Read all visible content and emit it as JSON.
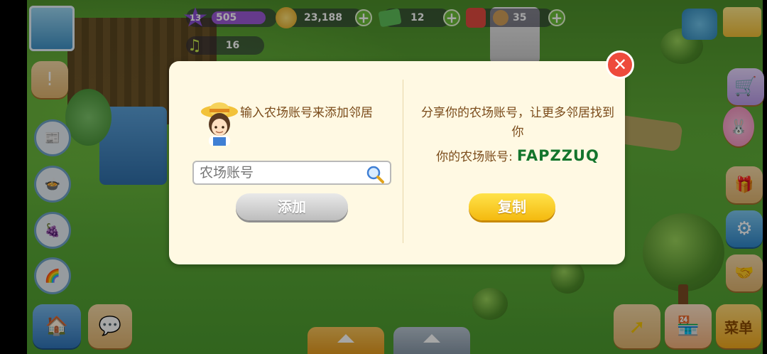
{
  "hud": {
    "level": "13",
    "xp": "505",
    "coins": "23,188",
    "cash": "12",
    "gifts": "35",
    "music_notes": "16"
  },
  "dialog": {
    "left_prompt": "输入农场账号来添加邻居",
    "input_placeholder": "农场账号",
    "add_label": "添加",
    "right_prompt": "分享你的农场账号，让更多邻居找到你",
    "account_label": "你的农场账号:",
    "account_code": "FAPZZUQ",
    "copy_label": "复制",
    "close_icon": "close-icon"
  },
  "bottom_bar": {
    "shop_label": "菜单"
  },
  "colors": {
    "dialog_bg": "#fff9e3",
    "text_brown": "#7a4b1a",
    "code_green": "#13752c",
    "close_red": "#ee4a3c",
    "copy_yellow": "#f4b90f"
  }
}
